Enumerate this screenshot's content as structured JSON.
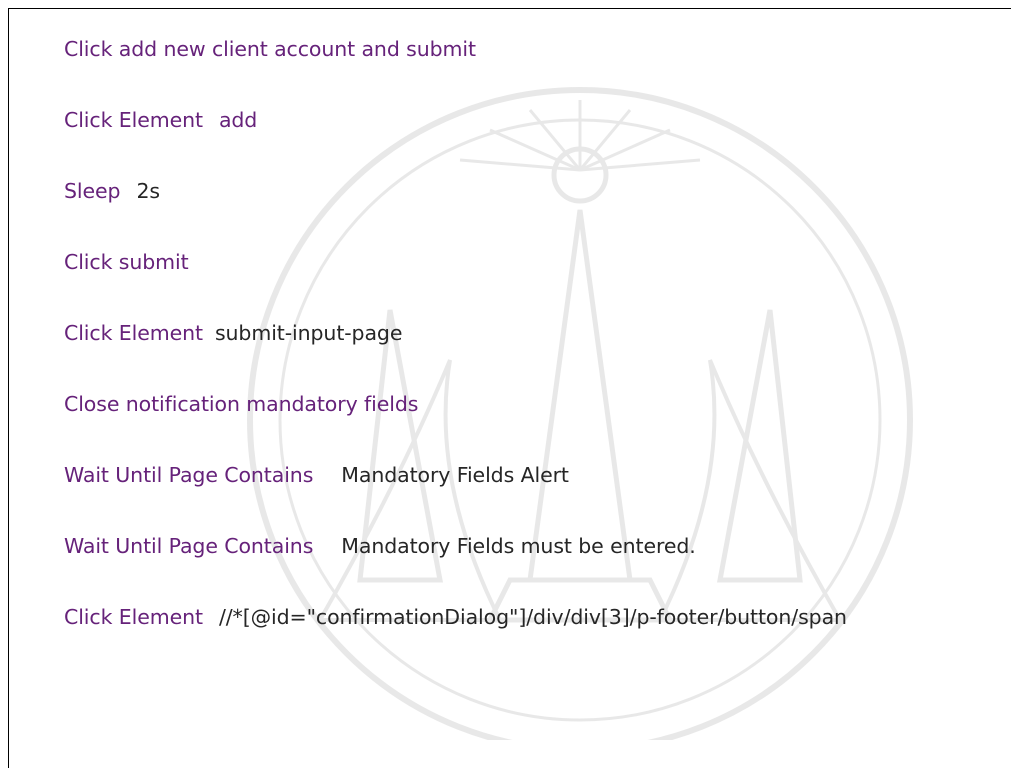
{
  "steps": [
    {
      "keyword": "Click add new client account and submit",
      "arg": ""
    },
    {
      "keyword": "Click Element",
      "arg": "add"
    },
    {
      "keyword": "Sleep",
      "arg": "2s"
    },
    {
      "keyword": "Click submit",
      "arg": ""
    },
    {
      "keyword": "Click Element",
      "arg": "submit-input-page"
    },
    {
      "keyword": "Close notification mandatory fields",
      "arg": ""
    },
    {
      "keyword": "Wait Until Page Contains",
      "arg": "Mandatory Fields Alert"
    },
    {
      "keyword": "Wait Until Page Contains",
      "arg": "Mandatory Fields must be entered."
    },
    {
      "keyword": "Click Element",
      "arg": "//*[@id=\"confirmationDialog\"]/div/div[3]/p-footer/button/span"
    }
  ],
  "colors": {
    "keyword": "#66227a",
    "argument": "#262626",
    "watermark": "#8a8a8a"
  },
  "watermark_icon": "university-seal-icon"
}
